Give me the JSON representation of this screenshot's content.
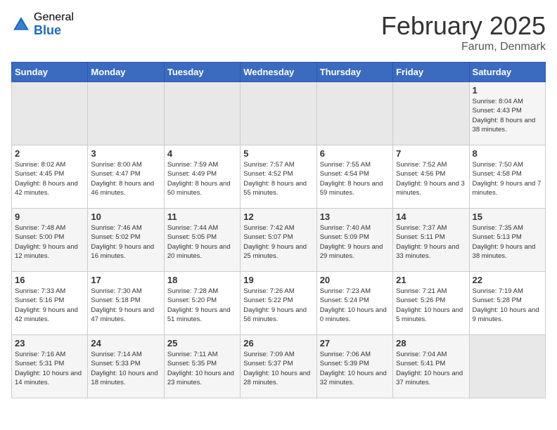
{
  "header": {
    "logo_general": "General",
    "logo_blue": "Blue",
    "title": "February 2025",
    "subtitle": "Farum, Denmark"
  },
  "weekdays": [
    "Sunday",
    "Monday",
    "Tuesday",
    "Wednesday",
    "Thursday",
    "Friday",
    "Saturday"
  ],
  "weeks": [
    [
      {
        "day": "",
        "info": ""
      },
      {
        "day": "",
        "info": ""
      },
      {
        "day": "",
        "info": ""
      },
      {
        "day": "",
        "info": ""
      },
      {
        "day": "",
        "info": ""
      },
      {
        "day": "",
        "info": ""
      },
      {
        "day": "1",
        "info": "Sunrise: 8:04 AM\nSunset: 4:43 PM\nDaylight: 8 hours and 38 minutes."
      }
    ],
    [
      {
        "day": "2",
        "info": "Sunrise: 8:02 AM\nSunset: 4:45 PM\nDaylight: 8 hours and 42 minutes."
      },
      {
        "day": "3",
        "info": "Sunrise: 8:00 AM\nSunset: 4:47 PM\nDaylight: 8 hours and 46 minutes."
      },
      {
        "day": "4",
        "info": "Sunrise: 7:59 AM\nSunset: 4:49 PM\nDaylight: 8 hours and 50 minutes."
      },
      {
        "day": "5",
        "info": "Sunrise: 7:57 AM\nSunset: 4:52 PM\nDaylight: 8 hours and 55 minutes."
      },
      {
        "day": "6",
        "info": "Sunrise: 7:55 AM\nSunset: 4:54 PM\nDaylight: 8 hours and 59 minutes."
      },
      {
        "day": "7",
        "info": "Sunrise: 7:52 AM\nSunset: 4:56 PM\nDaylight: 9 hours and 3 minutes."
      },
      {
        "day": "8",
        "info": "Sunrise: 7:50 AM\nSunset: 4:58 PM\nDaylight: 9 hours and 7 minutes."
      }
    ],
    [
      {
        "day": "9",
        "info": "Sunrise: 7:48 AM\nSunset: 5:00 PM\nDaylight: 9 hours and 12 minutes."
      },
      {
        "day": "10",
        "info": "Sunrise: 7:46 AM\nSunset: 5:02 PM\nDaylight: 9 hours and 16 minutes."
      },
      {
        "day": "11",
        "info": "Sunrise: 7:44 AM\nSunset: 5:05 PM\nDaylight: 9 hours and 20 minutes."
      },
      {
        "day": "12",
        "info": "Sunrise: 7:42 AM\nSunset: 5:07 PM\nDaylight: 9 hours and 25 minutes."
      },
      {
        "day": "13",
        "info": "Sunrise: 7:40 AM\nSunset: 5:09 PM\nDaylight: 9 hours and 29 minutes."
      },
      {
        "day": "14",
        "info": "Sunrise: 7:37 AM\nSunset: 5:11 PM\nDaylight: 9 hours and 33 minutes."
      },
      {
        "day": "15",
        "info": "Sunrise: 7:35 AM\nSunset: 5:13 PM\nDaylight: 9 hours and 38 minutes."
      }
    ],
    [
      {
        "day": "16",
        "info": "Sunrise: 7:33 AM\nSunset: 5:16 PM\nDaylight: 9 hours and 42 minutes."
      },
      {
        "day": "17",
        "info": "Sunrise: 7:30 AM\nSunset: 5:18 PM\nDaylight: 9 hours and 47 minutes."
      },
      {
        "day": "18",
        "info": "Sunrise: 7:28 AM\nSunset: 5:20 PM\nDaylight: 9 hours and 51 minutes."
      },
      {
        "day": "19",
        "info": "Sunrise: 7:26 AM\nSunset: 5:22 PM\nDaylight: 9 hours and 56 minutes."
      },
      {
        "day": "20",
        "info": "Sunrise: 7:23 AM\nSunset: 5:24 PM\nDaylight: 10 hours and 0 minutes."
      },
      {
        "day": "21",
        "info": "Sunrise: 7:21 AM\nSunset: 5:26 PM\nDaylight: 10 hours and 5 minutes."
      },
      {
        "day": "22",
        "info": "Sunrise: 7:19 AM\nSunset: 5:28 PM\nDaylight: 10 hours and 9 minutes."
      }
    ],
    [
      {
        "day": "23",
        "info": "Sunrise: 7:16 AM\nSunset: 5:31 PM\nDaylight: 10 hours and 14 minutes."
      },
      {
        "day": "24",
        "info": "Sunrise: 7:14 AM\nSunset: 5:33 PM\nDaylight: 10 hours and 18 minutes."
      },
      {
        "day": "25",
        "info": "Sunrise: 7:11 AM\nSunset: 5:35 PM\nDaylight: 10 hours and 23 minutes."
      },
      {
        "day": "26",
        "info": "Sunrise: 7:09 AM\nSunset: 5:37 PM\nDaylight: 10 hours and 28 minutes."
      },
      {
        "day": "27",
        "info": "Sunrise: 7:06 AM\nSunset: 5:39 PM\nDaylight: 10 hours and 32 minutes."
      },
      {
        "day": "28",
        "info": "Sunrise: 7:04 AM\nSunset: 5:41 PM\nDaylight: 10 hours and 37 minutes."
      },
      {
        "day": "",
        "info": ""
      }
    ]
  ]
}
